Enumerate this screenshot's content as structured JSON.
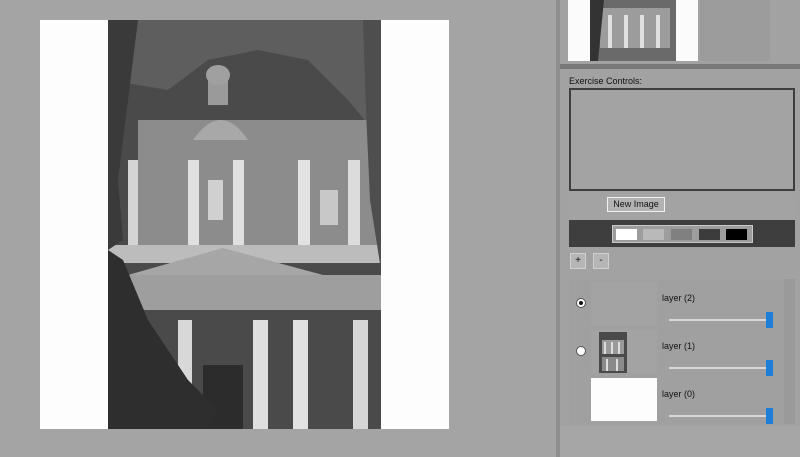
{
  "colors": {
    "background": "#a4a4a4",
    "canvas": "#fdfdfd",
    "panel": "#a2a2a2",
    "slider_accent": "#1f7fd8"
  },
  "exercise": {
    "label": "Exercise Controls:",
    "new_image_label": "New Image"
  },
  "swatches": [
    {
      "name": "white",
      "color": "#ffffff"
    },
    {
      "name": "light-gray",
      "color": "#b9b9b9"
    },
    {
      "name": "mid-gray",
      "color": "#808080"
    },
    {
      "name": "dark-gray",
      "color": "#3c3c3c"
    },
    {
      "name": "black",
      "color": "#000000"
    }
  ],
  "layer_controls": {
    "add_label": "+",
    "remove_label": "-"
  },
  "layers": [
    {
      "name": "layer (2)",
      "selected": true,
      "thumbnail": "blank",
      "opacity": 1.0
    },
    {
      "name": "layer (1)",
      "selected": false,
      "thumbnail": "photo",
      "opacity": 1.0
    },
    {
      "name": "layer (0)",
      "selected": null,
      "thumbnail": "white",
      "opacity": 1.0
    }
  ]
}
